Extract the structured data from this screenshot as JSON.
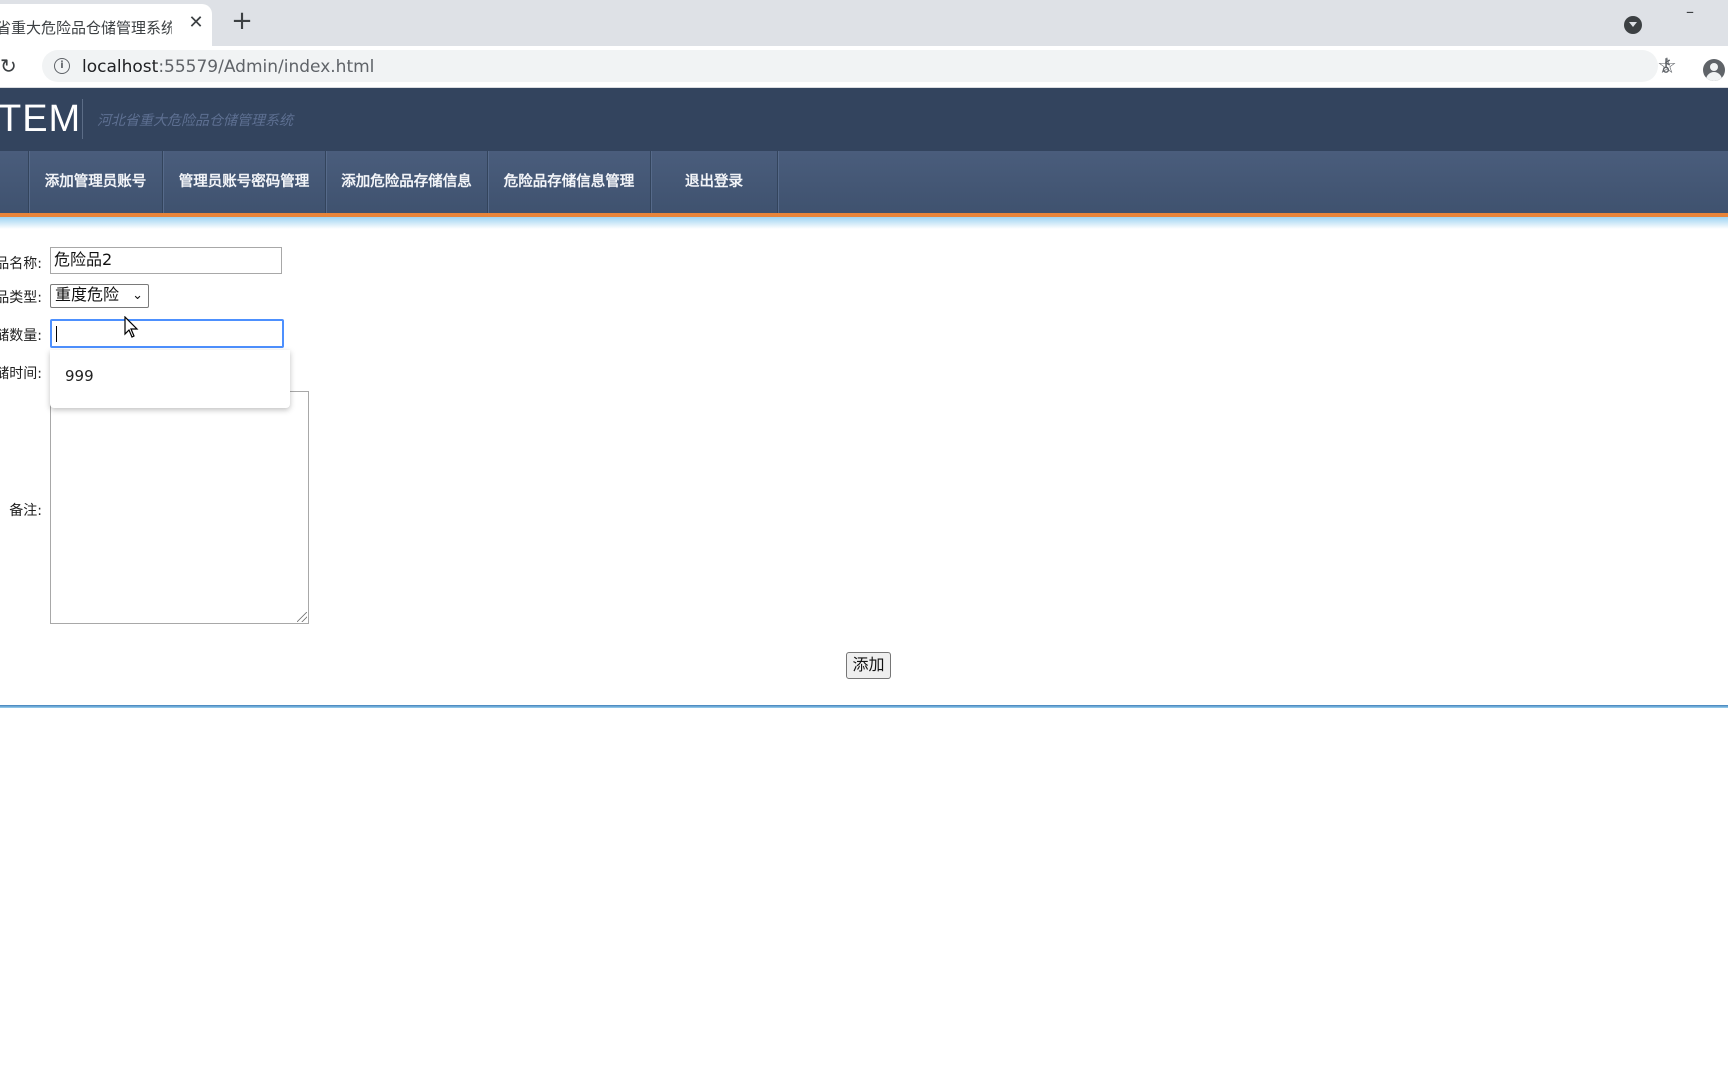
{
  "browser": {
    "tab_title": "省重大危险品仓储管理系统",
    "tab_close": "✕",
    "new_tab": "+",
    "minimize": "–",
    "url_host": "localhost",
    "url_rest": ":55579/Admin/index.html"
  },
  "header": {
    "logo_text": "TEM",
    "subtitle": "河北省重大危险品仓储管理系统"
  },
  "nav": {
    "items": [
      "添加管理员账号",
      "管理员账号密码管理",
      "添加危险品存储信息",
      "危险品存储信息管理",
      "退出登录"
    ]
  },
  "form": {
    "name_label": "品名称:",
    "name_value": "危险品2",
    "type_label": "品类型:",
    "type_value": "重度危险",
    "qty_label": "储数量:",
    "qty_value": "",
    "time_label": "储时间:",
    "remark_label": "备注:",
    "autocomplete_option": "999",
    "submit_label": "添加"
  }
}
